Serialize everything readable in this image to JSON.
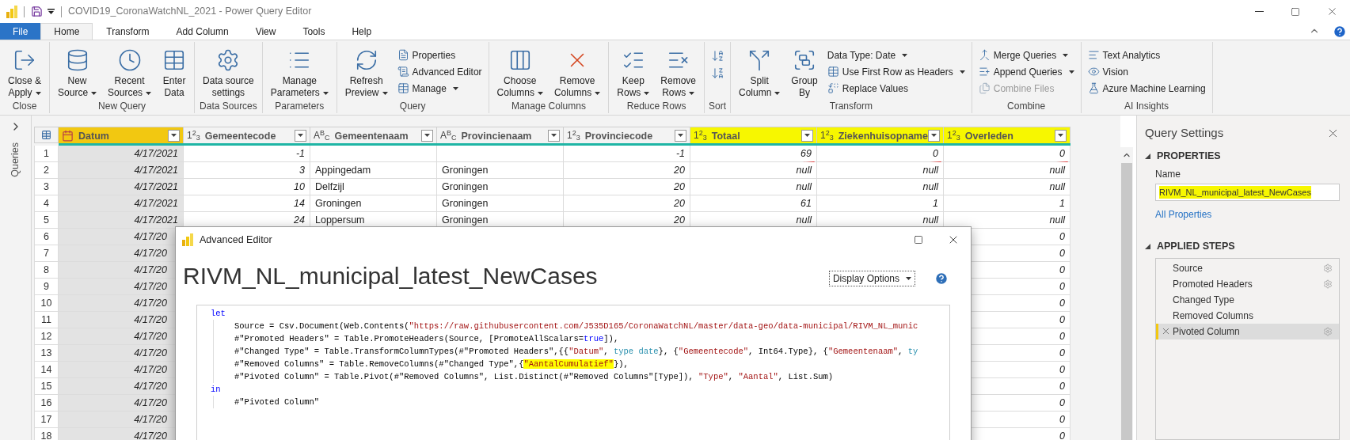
{
  "window": {
    "title": "COVID19_CoronaWatchNL_2021 - Power Query Editor"
  },
  "ribbon_tabs": [
    {
      "label": "File",
      "kind": "backstage",
      "selected": false
    },
    {
      "label": "Home",
      "kind": "tab",
      "selected": true
    },
    {
      "label": "Transform",
      "kind": "tab",
      "selected": false
    },
    {
      "label": "Add Column",
      "kind": "tab",
      "selected": false
    },
    {
      "label": "View",
      "kind": "tab",
      "selected": false
    },
    {
      "label": "Tools",
      "kind": "tab",
      "selected": false
    },
    {
      "label": "Help",
      "kind": "tab",
      "selected": false
    }
  ],
  "ribbon_groups": [
    {
      "label": "Close",
      "items": [
        {
          "kind": "large",
          "lines": [
            "Close &",
            "Apply"
          ],
          "dropdown": true
        }
      ]
    },
    {
      "label": "New Query",
      "items": [
        {
          "kind": "large",
          "lines": [
            "New",
            "Source"
          ],
          "dropdown": true
        },
        {
          "kind": "large",
          "lines": [
            "Recent",
            "Sources"
          ],
          "dropdown": true
        },
        {
          "kind": "large",
          "lines": [
            "Enter",
            "Data"
          ],
          "dropdown": false
        }
      ]
    },
    {
      "label": "Data Sources",
      "items": [
        {
          "kind": "large",
          "lines": [
            "Data source",
            "settings"
          ],
          "dropdown": false
        }
      ]
    },
    {
      "label": "Parameters",
      "items": [
        {
          "kind": "large",
          "lines": [
            "Manage",
            "Parameters"
          ],
          "dropdown": true
        }
      ]
    },
    {
      "label": "Query",
      "items": [
        {
          "kind": "large",
          "lines": [
            "Refresh",
            "Preview"
          ],
          "dropdown": true
        },
        {
          "kind": "small",
          "label": "Properties",
          "dropdown": false
        },
        {
          "kind": "small",
          "label": "Advanced Editor",
          "dropdown": false
        },
        {
          "kind": "small",
          "label": "Manage",
          "dropdown": true
        }
      ]
    },
    {
      "label": "Manage Columns",
      "items": [
        {
          "kind": "large",
          "lines": [
            "Choose",
            "Columns"
          ],
          "dropdown": true
        },
        {
          "kind": "large",
          "lines": [
            "Remove",
            "Columns"
          ],
          "dropdown": true
        }
      ]
    },
    {
      "label": "Reduce Rows",
      "items": [
        {
          "kind": "large",
          "lines": [
            "Keep",
            "Rows"
          ],
          "dropdown": true
        },
        {
          "kind": "large",
          "lines": [
            "Remove",
            "Rows"
          ],
          "dropdown": true
        }
      ]
    },
    {
      "label": "Sort",
      "items": [
        {
          "kind": "icon"
        },
        {
          "kind": "icon"
        }
      ]
    },
    {
      "label": "Transform",
      "items": [
        {
          "kind": "large",
          "lines": [
            "Split",
            "Column"
          ],
          "dropdown": true
        },
        {
          "kind": "large",
          "lines": [
            "Group",
            "By"
          ],
          "dropdown": false
        },
        {
          "kind": "small",
          "label": "Data Type: Date",
          "dropdown": true
        },
        {
          "kind": "small",
          "label": "Use First Row as Headers",
          "dropdown": true
        },
        {
          "kind": "small",
          "label": "Replace Values",
          "dropdown": false
        }
      ]
    },
    {
      "label": "Combine",
      "items": [
        {
          "kind": "small",
          "label": "Merge Queries",
          "dropdown": true,
          "disabled": false
        },
        {
          "kind": "small",
          "label": "Append Queries",
          "dropdown": true,
          "disabled": false
        },
        {
          "kind": "small",
          "label": "Combine Files",
          "dropdown": false,
          "disabled": true
        }
      ]
    },
    {
      "label": "AI Insights",
      "items": [
        {
          "kind": "small",
          "label": "Text Analytics",
          "dropdown": false
        },
        {
          "kind": "small",
          "label": "Vision",
          "dropdown": false
        },
        {
          "kind": "small",
          "label": "Azure Machine Learning",
          "dropdown": false
        }
      ]
    }
  ],
  "sidebar": {
    "label": "Queries"
  },
  "table": {
    "columns": [
      {
        "name": "Datum",
        "kind": "date",
        "selected": true,
        "highlighted": false
      },
      {
        "name": "Gemeentecode",
        "kind": "number",
        "type_label": "1$^{2}$$_{3}$",
        "selected": false,
        "highlighted": false
      },
      {
        "name": "Gemeentenaam",
        "kind": "text",
        "type_label": "A$^{B}$$_{C}$",
        "selected": false,
        "highlighted": false
      },
      {
        "name": "Provincienaam",
        "kind": "text",
        "type_label": "A$^{B}$$_{C}$",
        "selected": false,
        "highlighted": false
      },
      {
        "name": "Provinciecode",
        "kind": "number",
        "type_label": "1$^{2}$$_{3}$",
        "selected": false,
        "highlighted": false
      },
      {
        "name": "Totaal",
        "kind": "number",
        "type_label": "1$^{2}$$_{3}$",
        "selected": false,
        "highlighted": true
      },
      {
        "name": "Ziekenhuisopname",
        "kind": "number",
        "type_label": "1$^{2}$$_{3}$",
        "selected": false,
        "highlighted": true
      },
      {
        "name": "Overleden",
        "kind": "number",
        "type_label": "1$^{2}$$_{3}$",
        "selected": false,
        "highlighted": true
      }
    ],
    "rows": [
      {
        "number": "1",
        "kind": "full",
        "cells": [
          "4/17/2021",
          "-1",
          null,
          null,
          "-1",
          {
            "text": "69",
            "underlined": true
          },
          {
            "text": "0",
            "underlined": true
          },
          {
            "text": "0",
            "underlined": true
          }
        ]
      },
      {
        "number": "2",
        "kind": "full",
        "cells": [
          "4/17/2021",
          "3",
          "Appingedam",
          "Groningen",
          "20",
          "null",
          "null",
          "null"
        ]
      },
      {
        "number": "3",
        "kind": "full",
        "cells": [
          "4/17/2021",
          "10",
          "Delfzijl",
          "Groningen",
          "20",
          "null",
          "null",
          "null"
        ]
      },
      {
        "number": "4",
        "kind": "full",
        "cells": [
          "4/17/2021",
          "14",
          "Groningen",
          "Groningen",
          "20",
          "61",
          "1",
          "1"
        ]
      },
      {
        "number": "5",
        "kind": "full",
        "cells": [
          "4/17/2021",
          "24",
          "Loppersum",
          "Groningen",
          "20",
          "null",
          "null",
          "null"
        ]
      },
      {
        "number": "6",
        "kind": "covered",
        "cells": [
          "4/17/20",
          "0"
        ]
      },
      {
        "number": "7",
        "kind": "covered",
        "cells": [
          "4/17/20",
          "0"
        ]
      },
      {
        "number": "8",
        "kind": "covered",
        "cells": [
          "4/17/20",
          "0"
        ]
      },
      {
        "number": "9",
        "kind": "covered",
        "cells": [
          "4/17/20",
          "0"
        ]
      },
      {
        "number": "10",
        "kind": "covered",
        "cells": [
          "4/17/20",
          "0"
        ]
      },
      {
        "number": "11",
        "kind": "covered",
        "cells": [
          "4/17/20",
          "0"
        ]
      },
      {
        "number": "12",
        "kind": "covered",
        "cells": [
          "4/17/20",
          "0"
        ]
      },
      {
        "number": "13",
        "kind": "covered",
        "cells": [
          "4/17/20",
          "0"
        ]
      },
      {
        "number": "14",
        "kind": "covered",
        "cells": [
          "4/17/20",
          "0"
        ]
      },
      {
        "number": "15",
        "kind": "covered",
        "cells": [
          "4/17/20",
          "0"
        ]
      },
      {
        "number": "16",
        "kind": "covered",
        "cells": [
          "4/17/20",
          "0"
        ]
      },
      {
        "number": "17",
        "kind": "covered",
        "cells": [
          "4/17/20",
          "0"
        ]
      },
      {
        "number": "18",
        "kind": "covered",
        "cells": [
          "4/17/20",
          "0"
        ]
      }
    ]
  },
  "query_settings": {
    "title": "Query Settings",
    "properties_heading": "PROPERTIES",
    "name_label": "Name",
    "name_value": "RIVM_NL_municipal_latest_NewCases",
    "name_highlighted": true,
    "all_properties_link": "All Properties",
    "steps_heading": "APPLIED STEPS",
    "steps": [
      {
        "label": "Source",
        "has_settings": true,
        "selected": false
      },
      {
        "label": "Promoted Headers",
        "has_settings": true,
        "selected": false
      },
      {
        "label": "Changed Type",
        "has_settings": false,
        "selected": false
      },
      {
        "label": "Removed Columns",
        "has_settings": false,
        "selected": false
      },
      {
        "label": "Pivoted Column",
        "has_settings": true,
        "selected": true
      }
    ]
  },
  "advanced_editor": {
    "title": "Advanced Editor",
    "heading": "RIVM_NL_municipal_latest_NewCases",
    "display_options": "Display Options",
    "code_lines": [
      {
        "indent": false,
        "tokens": [
          {
            "kind": "keyword",
            "text": "let"
          }
        ]
      },
      {
        "indent": true,
        "tokens": [
          {
            "kind": "plain",
            "text": "Source = Csv.Document(Web.Contents("
          },
          {
            "kind": "string",
            "text": "\"https://raw.githubusercontent.com/J535D165/CoronaWatchNL/master/data-geo/data-municipal/RIVM_NL_munic"
          }
        ]
      },
      {
        "indent": true,
        "tokens": [
          {
            "kind": "plain",
            "text": "#\"Promoted Headers\" = Table.PromoteHeaders(Source, [PromoteAllScalars="
          },
          {
            "kind": "keyword",
            "text": "true"
          },
          {
            "kind": "plain",
            "text": "]),"
          }
        ]
      },
      {
        "indent": true,
        "tokens": [
          {
            "kind": "plain",
            "text": "#\"Changed Type\" = Table.TransformColumnTypes(#\"Promoted Headers\",{{"
          },
          {
            "kind": "string",
            "text": "\"Datum\""
          },
          {
            "kind": "plain",
            "text": ", "
          },
          {
            "kind": "type",
            "text": "type date"
          },
          {
            "kind": "plain",
            "text": "}, {"
          },
          {
            "kind": "string",
            "text": "\"Gemeentecode\""
          },
          {
            "kind": "plain",
            "text": ", Int64.Type}, {"
          },
          {
            "kind": "string",
            "text": "\"Gemeentenaam\""
          },
          {
            "kind": "plain",
            "text": ", "
          },
          {
            "kind": "type",
            "text": "ty"
          }
        ]
      },
      {
        "indent": true,
        "tokens": [
          {
            "kind": "plain",
            "text": "#\"Removed Columns\" = Table.RemoveColumns(#\"Changed Type\",{"
          },
          {
            "kind": "highlight",
            "text": "\"AantalCumulatief\""
          },
          {
            "kind": "plain",
            "text": "}),"
          }
        ]
      },
      {
        "indent": true,
        "tokens": [
          {
            "kind": "plain",
            "text": "#\"Pivoted Column\" = Table.Pivot(#\"Removed Columns\", List.Distinct(#\"Removed Columns\"[Type]), "
          },
          {
            "kind": "string",
            "text": "\"Type\""
          },
          {
            "kind": "plain",
            "text": ", "
          },
          {
            "kind": "string",
            "text": "\"Aantal\""
          },
          {
            "kind": "plain",
            "text": ", List.Sum)"
          }
        ]
      },
      {
        "indent": false,
        "tokens": [
          {
            "kind": "keyword",
            "text": "in"
          }
        ]
      },
      {
        "indent": true,
        "tokens": [
          {
            "kind": "plain",
            "text": "#\"Pivoted Column\""
          }
        ]
      }
    ]
  }
}
